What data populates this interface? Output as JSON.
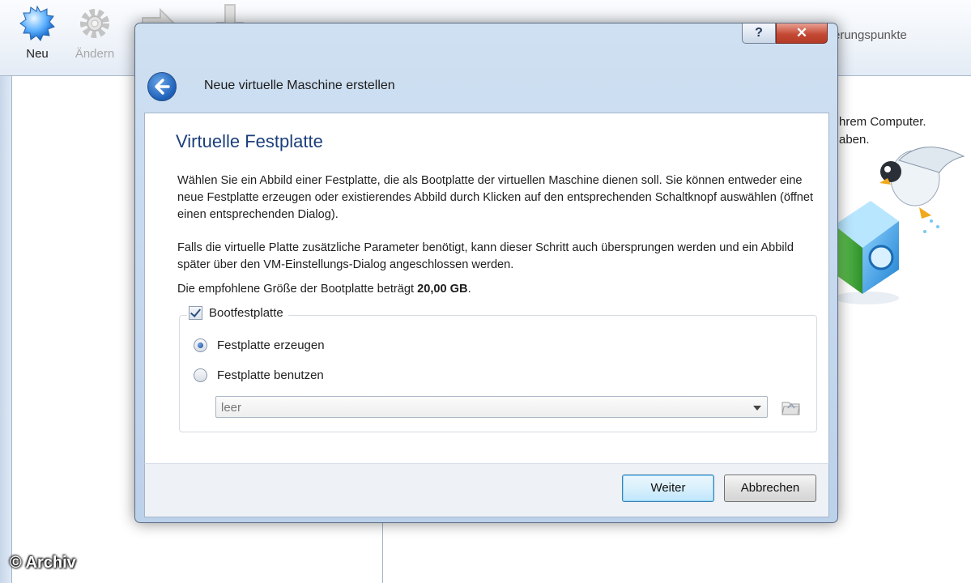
{
  "toolbar": {
    "new_label": "Neu",
    "change_label": "Ändern",
    "snapshots_label_fragment": "erungspunkte"
  },
  "right_pane": {
    "line1": "hrem Computer.",
    "line2": "aben."
  },
  "watermark": "© Archiv",
  "dialog": {
    "help_button": "?",
    "close_button": "✕",
    "header_title": "Neue virtuelle Maschine erstellen",
    "page_heading": "Virtuelle Festplatte",
    "paragraph1": "Wählen Sie ein Abbild einer Festplatte, die als Bootplatte der virtuellen Maschine dienen soll. Sie können entweder eine neue Festplatte erzeugen oder existierendes Abbild durch Klicken auf den entsprechenden Schaltknopf auswählen (öffnet einen entsprechenden Dialog).",
    "paragraph2": "Falls die virtuelle Platte zusätzliche Parameter benötigt, kann dieser Schritt auch übersprungen werden und ein Abbild später über den VM-Einstellungs-Dialog angeschlossen werden.",
    "recommended_prefix": "Die empfohlene Größe der Bootplatte beträgt",
    "recommended_size": "20,00 GB",
    "recommended_suffix": ".",
    "boot_disk_checkbox": "Bootfestplatte",
    "boot_disk_checked": true,
    "radio_create": "Festplatte erzeugen",
    "radio_use": "Festplatte benutzen",
    "selected_option": "Festplatte erzeugen",
    "combo_value": "leer",
    "next_button": "Weiter",
    "cancel_button": "Abbrechen"
  },
  "colors": {
    "heading": "#1c3f7a",
    "close_button": "#c54a36",
    "default_button_border": "#3c7fb1"
  }
}
